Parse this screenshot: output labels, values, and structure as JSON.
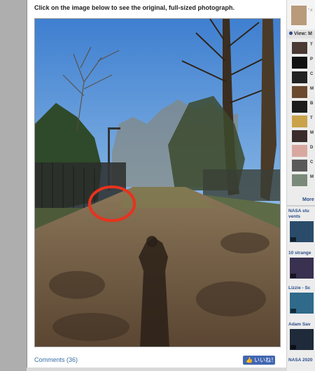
{
  "main": {
    "instruction": "Click on the image below to see the original, full-sized photograph.",
    "comments_link": "Comments (36)",
    "like_button": "いいね！"
  },
  "sidebar": {
    "top_item_text": "\" d",
    "view_label": "View: M",
    "list_letters": [
      "T",
      "P",
      "C",
      "M",
      "B",
      "T",
      "M",
      "D",
      "C",
      "M"
    ],
    "more_label": "More",
    "videos": [
      {
        "label": "NASA stu",
        "label2": "vents"
      },
      {
        "label": "10 strange"
      },
      {
        "label": "Lizzie - Sc"
      },
      {
        "label": "Adam Sav"
      },
      {
        "label": "NASA 2020"
      }
    ]
  },
  "colors": {
    "link": "#3a6ea5",
    "sidebar_link": "#2a4d8a",
    "like_button": "#4267b2",
    "circle_annotation": "#e8321e"
  }
}
